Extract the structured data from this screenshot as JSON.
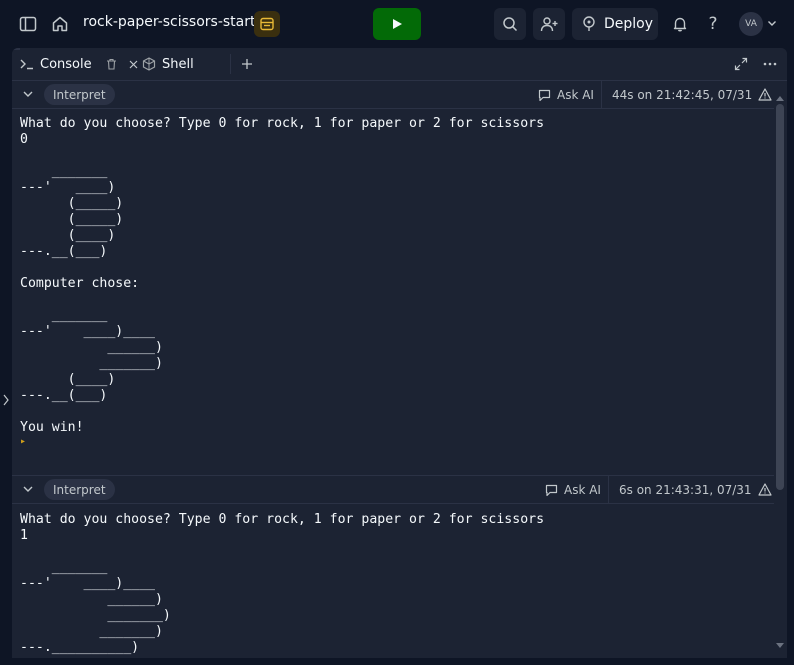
{
  "header": {
    "project_title": "rock-paper-scissors-start",
    "deploy_label": "Deploy",
    "avatar_initials": "VA"
  },
  "tabs": [
    {
      "label": "Console",
      "active": true
    },
    {
      "label": "Shell",
      "active": false
    }
  ],
  "runs": [
    {
      "interpret_label": "Interpret",
      "ask_ai_label": "Ask AI",
      "time_label": "44s on 21:42:45, 07/31",
      "output": "What do you choose? Type 0 for rock, 1 for paper or 2 for scissors\n0\n\n    _______\n---'   ____)\n      (_____)\n      (_____)\n      (____)\n---.__(___)\n\nComputer chose:\n\n    _______\n---'    ____)____\n           ______)\n          _______)\n      (____)\n---.__(___)\n\nYou win!"
    },
    {
      "interpret_label": "Interpret",
      "ask_ai_label": "Ask AI",
      "time_label": "6s on 21:43:31, 07/31",
      "output": "What do you choose? Type 0 for rock, 1 for paper or 2 for scissors\n1\n\n    _______\n---'    ____)____\n           ______)\n           _______)\n          _______)\n---.__________)"
    }
  ],
  "colors": {
    "background": "#0e1525",
    "panel": "#1c2333",
    "run_button": "#036a07",
    "prompt_glyph": "#d4a21a"
  },
  "icons": [
    "sidebar-toggle-icon",
    "home-icon",
    "project-icon",
    "play-icon",
    "search-icon",
    "invite-user-icon",
    "deploy-icon",
    "bell-icon",
    "help-icon",
    "chevron-down-icon",
    "console-icon",
    "trash-icon",
    "close-icon",
    "shell-icon",
    "plus-icon",
    "expand-icon",
    "more-icon",
    "ask-ai-icon",
    "warning-icon"
  ]
}
